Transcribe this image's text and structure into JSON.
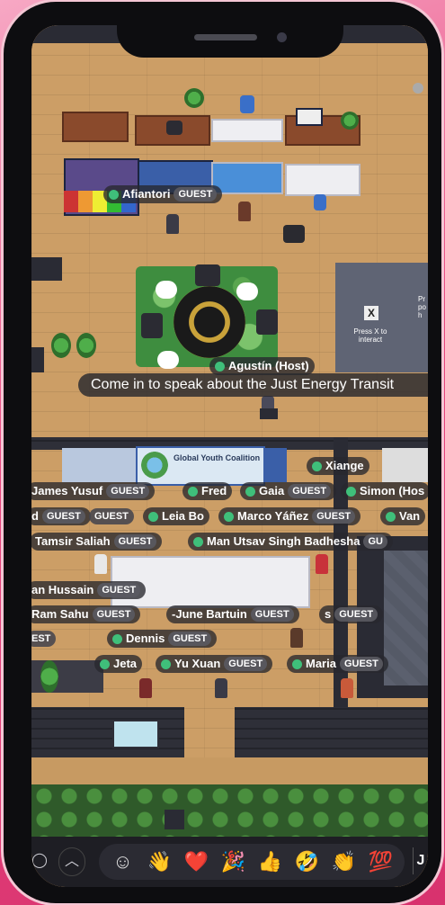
{
  "speech_bubble": "Come in to speak about the Just Energy Transit",
  "sign_banner": {
    "title": "Global Youth Coalition"
  },
  "press_sign": {
    "key": "X",
    "text": "Press X to interact",
    "side_text": "Pr po h"
  },
  "participants": [
    {
      "name": "Afiantori",
      "role": "GUEST"
    },
    {
      "name": "Agustín (Host)",
      "role": ""
    },
    {
      "name": "Xiange",
      "role": ""
    },
    {
      "name": "James Yusuf",
      "role": "GUEST"
    },
    {
      "name": "Fred",
      "role": ""
    },
    {
      "name": "Gaia",
      "role": "GUEST"
    },
    {
      "name": "Simon (Hos",
      "role": ""
    },
    {
      "name": "d",
      "role": "GUEST"
    },
    {
      "name": "",
      "role": "GUEST"
    },
    {
      "name": "Leia Bo",
      "role": ""
    },
    {
      "name": "Marco Yáñez",
      "role": "GUEST"
    },
    {
      "name": "Van",
      "role": ""
    },
    {
      "name": "Tamsir Saliah",
      "role": "GUEST"
    },
    {
      "name": "Man Utsav Singh Badhesha",
      "role": "GU"
    },
    {
      "name": "an Hussain",
      "role": "GUEST"
    },
    {
      "name": "Ram Sahu",
      "role": "GUEST"
    },
    {
      "name": "-June Bartuin",
      "role": "GUEST"
    },
    {
      "name": "s",
      "role": "GUEST"
    },
    {
      "name": "EST",
      "role": ""
    },
    {
      "name": "Dennis",
      "role": "GUEST"
    },
    {
      "name": "Jeta",
      "role": ""
    },
    {
      "name": "Yu Xuan",
      "role": "GUEST"
    },
    {
      "name": "Maria",
      "role": "GUEST"
    }
  ],
  "toolbar": {
    "more_icon": "circle-icon",
    "expand_icon": "chevron-up-icon",
    "emoji_picker_icon": "smiley-icon",
    "reactions": [
      "👋",
      "❤️",
      "🎉",
      "👍",
      "🤣",
      "👏",
      "💯"
    ],
    "edge_label": "J"
  },
  "colors": {
    "status_online": "#3fbf7a",
    "frame_pink": "#e8467f"
  }
}
